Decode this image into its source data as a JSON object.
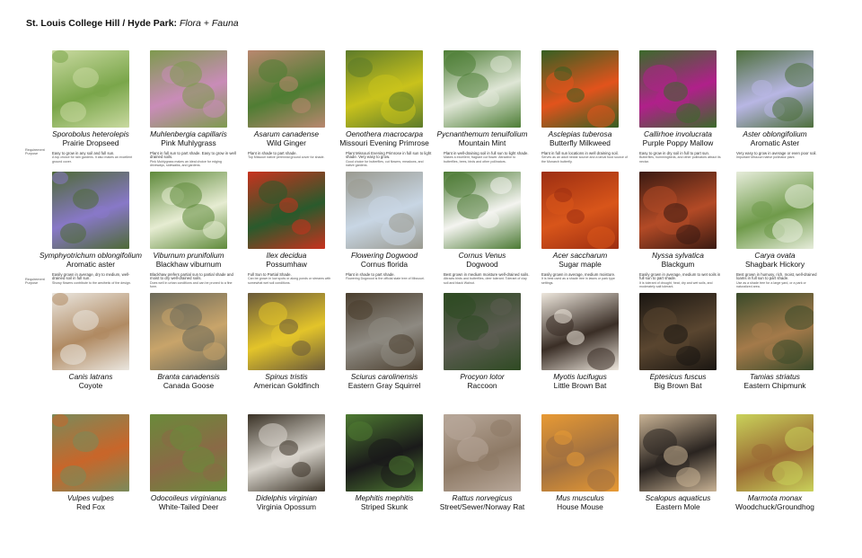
{
  "title": {
    "bold": "St. Louis College Hill / Hyde Park:",
    "italic": "Flora + Fauna"
  },
  "requirement_label": [
    "Requirement",
    "Purpose"
  ],
  "plants_row1": [
    {
      "sci": "Sporobolus heterolepis",
      "common": "Prairie Dropseed",
      "req": "Easy to grow in any soil and full sun.",
      "purpose": "A top choice for rain gardens. It also makes an excellent ground cover."
    },
    {
      "sci": "Muhlenbergia capillaris",
      "common": "Pink Muhlygrass",
      "req": "Plant in full sun to part shade. Easy to grow in well drained soils.",
      "purpose": "Pink Muhlygrass makes an ideal choice for edging driveways, sidewalks, and gardens."
    },
    {
      "sci": "Asarum canadense",
      "common": "Wild Ginger",
      "req": "Plant in shade to part shade.",
      "purpose": "Top Missouri native perennial ground cover for shade."
    },
    {
      "sci": "Oenothera macrocarpa",
      "common": "Missouri Evening Primrose",
      "req": "Plant Missouri Evening Primrose in full sun to light shade. Very easy to grow.",
      "purpose": "Good choice for butterflies, cut flowers, meadows, and native gardens."
    },
    {
      "sci": "Pycnanthemum tenuifolium",
      "common": "Mountain Mint",
      "req": "Plant in well-draining soil in full sun to light shade.",
      "purpose": "Makes a excellent, fragrant cut flower. Attractive to butterflies, bees, birds and other pollinators."
    },
    {
      "sci": "Asclepias tuberosa",
      "common": "Butterfly Milkweed",
      "req": "Plant in full sun locations in well draining soil.",
      "purpose": "Serves as an adult nectar source and a larval food source of the Monarch butterfly."
    },
    {
      "sci": "Callirhoe involucrata",
      "common": "Purple Poppy Mallow",
      "req": "Easy to grow in dry soil in full to part sun.",
      "purpose": "Butterflies, hummingbirds, and other pollinators attract its nectar."
    },
    {
      "sci": "Aster oblongifolium",
      "common": "Aromatic Aster",
      "req": "Very easy to grow in average or even poor soil.",
      "purpose": "Important Missouri native pollinator plant."
    }
  ],
  "plants_row2": [
    {
      "sci": "Symphyotrichum oblongifolium",
      "common": "Aromatic aster",
      "req": "Easily grown in average, dry to medium, well-drained soil in full sun.",
      "purpose": "Showy flowers contribute to the aesthetic of the design."
    },
    {
      "sci": "Viburnum prunifolium",
      "common": "Blackhaw viburnum",
      "req": "Blackhaw prefers partial sun to partial shade and moist to dry well-drained soils.",
      "purpose": "Does well in urban conditions and can be pruned to a fine form."
    },
    {
      "sci": "Ilex decidua",
      "common": "Possumhaw",
      "req": "Full Sun to Partial Shade.",
      "purpose": "Can be grown in low spots or along ponds or streams with somewhat wet soil conditions."
    },
    {
      "sci": "Flowering Dogwood",
      "common": "Cornus florida",
      "req": "Plant in shade to part shade.",
      "purpose": "Flowering Dogwood is the official state tree of Missouri."
    },
    {
      "sci": "Cornus Venus",
      "common": "Dogwood",
      "req": "Best grown in medium moisture well-drained soils.",
      "purpose": "Attracts birds and butterflies, deer tolerant. Tolerant of clay soil and black Walnut."
    },
    {
      "sci": "Acer saccharum",
      "common": "Sugar maple",
      "req": "Easily grown in average, medium moisture.",
      "purpose": "It is best used as a shade tree in lawns or park type settings."
    },
    {
      "sci": "Nyssa sylvatica",
      "common": "Blackgum",
      "req": "Easily grown in average, medium to wet soils in full sun to part shade.",
      "purpose": "It is tolerant of drought, heat, dry and wet soils, and moderately salt tolerant."
    },
    {
      "sci": "Carya ovata",
      "common": "Shagbark Hickory",
      "req": "Best grown in humusy, rich, moist, well-drained loams in full sun to part shade.",
      "purpose": "Use as a shade tree for a large yard, or a park or naturalized area."
    }
  ],
  "animals_row1": [
    {
      "sci": "Canis latrans",
      "common": "Coyote"
    },
    {
      "sci": "Branta canadensis",
      "common": "Canada Goose"
    },
    {
      "sci": "Spinus tristis",
      "common": "American Goldfinch"
    },
    {
      "sci": "Sciurus carolinensis",
      "common": "Eastern Gray Squirrel"
    },
    {
      "sci": "Procyon lotor",
      "common": "Raccoon"
    },
    {
      "sci": "Myotis lucifugus",
      "common": "Little Brown Bat"
    },
    {
      "sci": "Eptesicus fuscus",
      "common": "Big Brown Bat"
    },
    {
      "sci": "Tamias striatus",
      "common": "Eastern Chipmunk"
    }
  ],
  "animals_row2": [
    {
      "sci": "Vulpes vulpes",
      "common": "Red Fox"
    },
    {
      "sci": "Odocoileus virginianus",
      "common": "White-Tailed Deer"
    },
    {
      "sci": "Didelphis virginian",
      "common": "Virginia Opossum"
    },
    {
      "sci": "Mephitis mephitis",
      "common": "Striped Skunk"
    },
    {
      "sci": "Rattus norvegicus",
      "common": "Street/Sewer/Norway Rat"
    },
    {
      "sci": "Mus musculus",
      "common": "House Mouse"
    },
    {
      "sci": "Scalopus aquaticus",
      "common": "Eastern Mole"
    },
    {
      "sci": "Marmota monax",
      "common": "Woodchuck/Groundhog"
    }
  ],
  "photo_colors": {
    "plants_row1": [
      [
        "#7aa64a",
        "#c9d9a0"
      ],
      [
        "#c98cb8",
        "#7e9a4e"
      ],
      [
        "#4f7d33",
        "#b9876f"
      ],
      [
        "#c9c21c",
        "#5d7b2a"
      ],
      [
        "#dfe6d6",
        "#4d7d35"
      ],
      [
        "#e2531c",
        "#355f23"
      ],
      [
        "#b0208a",
        "#3b6a2a"
      ],
      [
        "#b8b6e4",
        "#4d6f3b"
      ]
    ],
    "plants_row2": [
      [
        "#8878c8",
        "#4e6a36"
      ],
      [
        "#e6ecd2",
        "#5f8a3b"
      ],
      [
        "#2a5a2c",
        "#c8321e"
      ],
      [
        "#c8d6e4",
        "#9a9a90"
      ],
      [
        "#f4f4f0",
        "#4c7a34"
      ],
      [
        "#d8551a",
        "#9c2e12"
      ],
      [
        "#b34a26",
        "#3a1a12"
      ],
      [
        "#6f9a4a",
        "#e6ecda"
      ]
    ],
    "animals_row1": [
      [
        "#b08a62",
        "#eae6df"
      ],
      [
        "#c8a46a",
        "#6c6a5a"
      ],
      [
        "#e3c42a",
        "#6a5a3a"
      ],
      [
        "#8e8a82",
        "#4a3e2e"
      ],
      [
        "#5c5c52",
        "#2e4a22"
      ],
      [
        "#3a2e26",
        "#eee7dd"
      ],
      [
        "#5a4630",
        "#1a1612"
      ],
      [
        "#a47a4a",
        "#3a4a2a"
      ]
    ],
    "animals_row2": [
      [
        "#c8662a",
        "#7a8a5a"
      ],
      [
        "#8a6a46",
        "#6a8a3a"
      ],
      [
        "#d8d4cc",
        "#3a3226"
      ],
      [
        "#1a1a1a",
        "#4e7a32"
      ],
      [
        "#8e7a66",
        "#b8a89a"
      ],
      [
        "#a07040",
        "#e89a34"
      ],
      [
        "#2a2420",
        "#c8b294"
      ],
      [
        "#9a6a34",
        "#c9d25a"
      ]
    ]
  }
}
